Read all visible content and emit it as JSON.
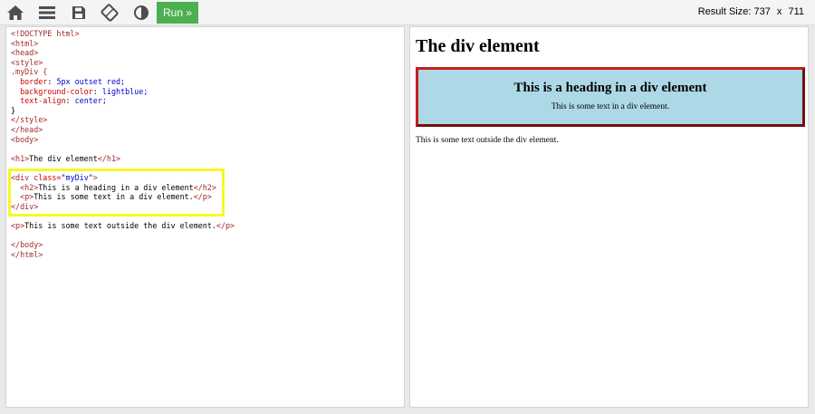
{
  "toolbar": {
    "icons": [
      "home-icon",
      "menu-icon",
      "save-icon",
      "rotate-icon",
      "contrast-icon"
    ],
    "run_label": "Run »",
    "result_size_label": "Result Size:",
    "result_width": "737",
    "result_x": "x",
    "result_height": "711"
  },
  "editor": {
    "lines": [
      {
        "t": "<!DOCTYPE html>"
      },
      {
        "t": "<html>"
      },
      {
        "t": "<head>"
      },
      {
        "t": "<style>"
      },
      {
        "t": ".myDiv {"
      },
      {
        "t": "  border: 5px outset red;"
      },
      {
        "t": "  background-color: lightblue;"
      },
      {
        "t": "  text-align: center;"
      },
      {
        "t": "}"
      },
      {
        "t": "</style>"
      },
      {
        "t": "</head>"
      },
      {
        "t": "<body>"
      },
      {
        "t": ""
      },
      {
        "t": "<h1>The div element</h1>"
      },
      {
        "t": ""
      },
      {
        "t": "<div class=\"myDiv\">"
      },
      {
        "t": "  <h2>This is a heading in a div element</h2>"
      },
      {
        "t": "  <p>This is some text in a div element.</p>"
      },
      {
        "t": "</div>"
      },
      {
        "t": ""
      },
      {
        "t": "<p>This is some text outside the div element.</p>"
      },
      {
        "t": ""
      },
      {
        "t": "</body>"
      },
      {
        "t": "</html>"
      }
    ]
  },
  "result": {
    "h1": "The div element",
    "div_heading": "This is a heading in a div element",
    "div_text": "This is some text in a div element.",
    "outside_text": "This is some text outside the div element."
  },
  "colors": {
    "run_button": "#4caf50",
    "highlight": "#f7f727",
    "div_background": "#add8e6",
    "div_border": "#c41e1e"
  }
}
